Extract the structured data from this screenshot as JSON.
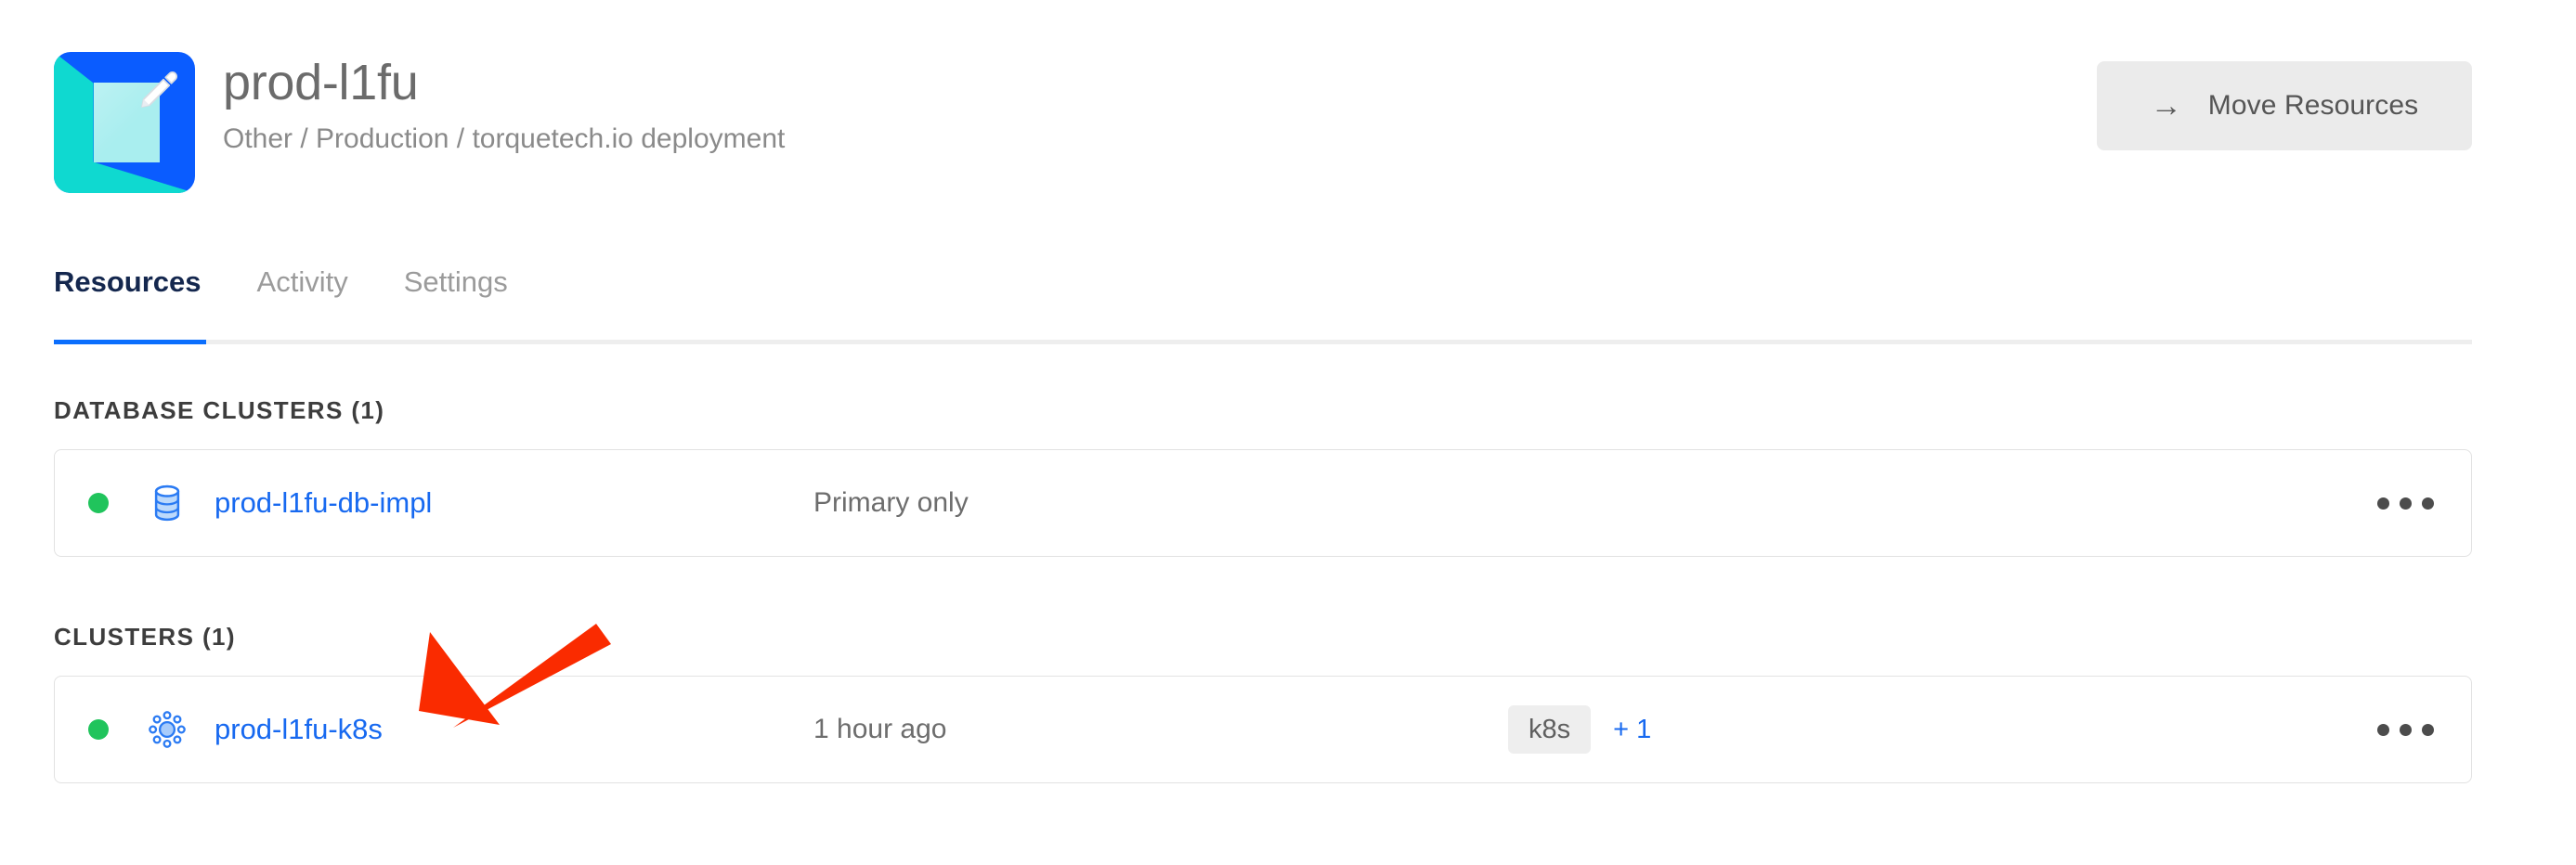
{
  "header": {
    "title": "prod-l1fu",
    "breadcrumb": "Other / Production / torquetech.io deployment",
    "avatar_icon": "project-avatar-pencil-icon",
    "move_button": {
      "label": "Move Resources",
      "arrow_glyph": "→",
      "icon": "arrow-right-icon"
    }
  },
  "tabs": [
    {
      "label": "Resources",
      "active": true
    },
    {
      "label": "Activity",
      "active": false
    },
    {
      "label": "Settings",
      "active": false
    }
  ],
  "sections": [
    {
      "title": "DATABASE CLUSTERS (1)",
      "rows": [
        {
          "status": "online",
          "icon": "database-icon",
          "name": "prod-l1fu-db-impl",
          "meta": "Primary only",
          "tags": [],
          "tags_more": "",
          "menu_icon": "kebab-menu-icon"
        }
      ]
    },
    {
      "title": "CLUSTERS (1)",
      "rows": [
        {
          "status": "online",
          "icon": "kubernetes-icon",
          "name": "prod-l1fu-k8s",
          "meta": "1 hour ago",
          "tags": [
            "k8s"
          ],
          "tags_more": "+ 1",
          "menu_icon": "kebab-menu-icon"
        }
      ]
    }
  ],
  "annotation": {
    "type": "arrow",
    "color": "#fa2b00",
    "points_to": "prod-l1fu-k8s"
  },
  "colors": {
    "link_blue": "#1769f0",
    "tab_active": "#14274e",
    "tab_underline": "#0b6efd",
    "status_green": "#20c45c",
    "avatar_blue": "#0a5cff",
    "avatar_cyan": "#0fd9d0",
    "annotation_red": "#fa2b00"
  }
}
